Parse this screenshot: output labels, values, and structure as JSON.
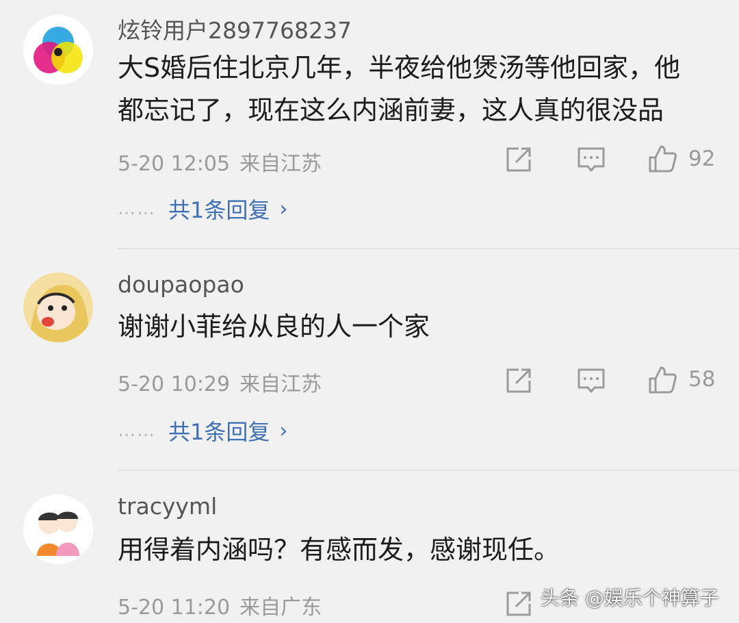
{
  "comments": [
    {
      "username": "炫铃用户2897768237",
      "text_lines": [
        "大S婚后住北京几年，半夜给他煲汤等他回家，他",
        "都忘记了，现在这么内涵前妻，这人真的很没品"
      ],
      "date": "5-20 12:05",
      "location": "来自江苏",
      "likes": "92",
      "replies": {
        "dots": "……",
        "label": "共1条回复",
        "chevron": "›"
      }
    },
    {
      "username": "doupaopao",
      "text_lines": [
        "谢谢小菲给从良的人一个家"
      ],
      "date": "5-20 10:29",
      "location": "来自江苏",
      "likes": "58",
      "replies": {
        "dots": "……",
        "label": "共1条回复",
        "chevron": "›"
      }
    },
    {
      "username": "tracyyml",
      "text_lines": [
        "用得着内涵吗？有感而发，感谢现任。"
      ],
      "date": "5-20 11:20",
      "location": "来自广东"
    }
  ],
  "icons": {
    "share": "share-icon",
    "comment": "comment-icon",
    "like": "thumbs-up-icon"
  },
  "colors": {
    "background": "#f1f1f1",
    "link": "#3f6fb4",
    "meta": "#9a9a9a"
  },
  "watermark": "头条 @娱乐个神算子"
}
